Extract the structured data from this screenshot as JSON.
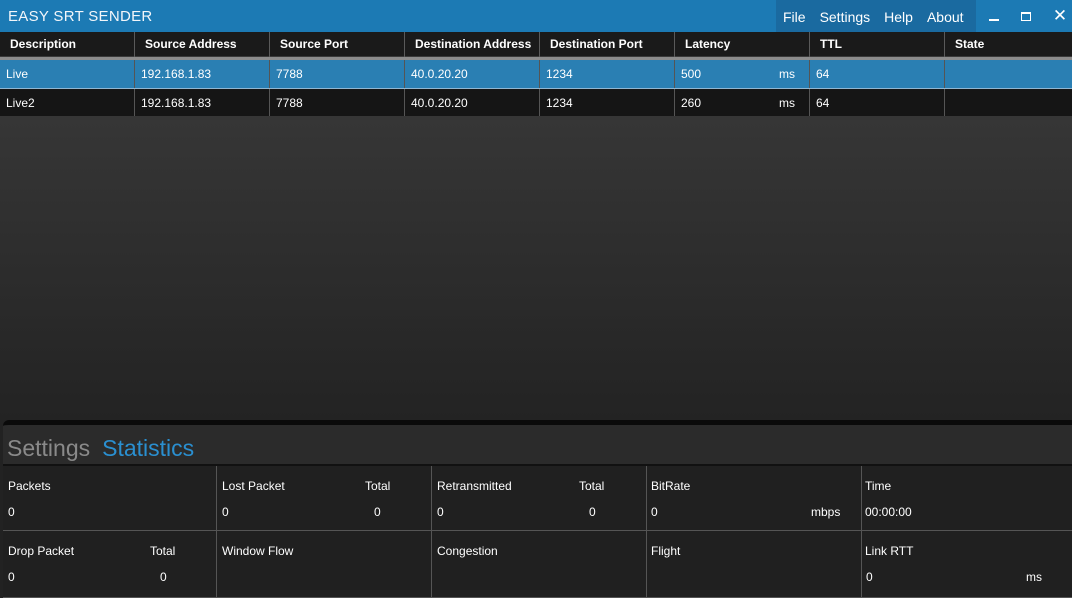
{
  "app": {
    "title": "EASY SRT SENDER",
    "menu": [
      "File",
      "Settings",
      "Help",
      "About"
    ],
    "window_controls": {
      "close_glyph": "✕"
    }
  },
  "table": {
    "columns": [
      "Description",
      "Source Address",
      "Source Port",
      "Destination Address",
      "Destination Port",
      "Latency",
      "TTL",
      "State"
    ],
    "rows": [
      {
        "description": "Live",
        "source_address": "192.168.1.83",
        "source_port": "7788",
        "destination_address": "40.0.20.20",
        "destination_port": "1234",
        "latency": "500",
        "latency_unit": "ms",
        "ttl": "64",
        "state": "",
        "selected": true
      },
      {
        "description": "Live2",
        "source_address": "192.168.1.83",
        "source_port": "7788",
        "destination_address": "40.0.20.20",
        "destination_port": "1234",
        "latency": "260",
        "latency_unit": "ms",
        "ttl": "64",
        "state": "",
        "selected": false
      }
    ]
  },
  "tabs": {
    "settings": "Settings",
    "statistics": "Statistics",
    "active": "statistics"
  },
  "stats": {
    "packets": {
      "label": "Packets",
      "value": "0"
    },
    "lost_packet": {
      "label": "Lost Packet",
      "value": "0",
      "total_label": "Total",
      "total_value": "0"
    },
    "retransmitted": {
      "label": "Retransmitted",
      "value": "0",
      "total_label": "Total",
      "total_value": "0"
    },
    "bitrate": {
      "label": "BitRate",
      "value": "0",
      "unit": "mbps"
    },
    "time": {
      "label": "Time",
      "value": "00:00:00"
    },
    "drop_packet": {
      "label": "Drop Packet",
      "value": "0",
      "total_label": "Total",
      "total_value": "0"
    },
    "window_flow": {
      "label": "Window Flow"
    },
    "congestion": {
      "label": "Congestion"
    },
    "flight": {
      "label": "Flight"
    },
    "link_rtt": {
      "label": "Link RTT",
      "value": "0",
      "unit": "ms"
    }
  },
  "colors": {
    "accent": "#1c7ab4",
    "selected_row": "#2a7fb3",
    "active_tab": "#2a8fd0"
  }
}
